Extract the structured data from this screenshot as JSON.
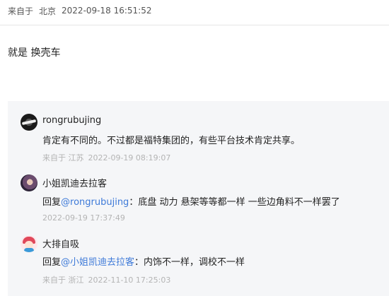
{
  "post": {
    "source_prefix": "来自于",
    "location": "北京",
    "datetime": "2022-09-18 16:51:52",
    "body": "就是 换壳车"
  },
  "replies": [
    {
      "username": "rongrubujing",
      "avatar_icon": "dark-logo-avatar",
      "content": "肯定有不同的。不过都是福特集团的，有些平台技术肯定共享。",
      "meta_source": "来自于 江苏",
      "datetime": "2022-09-19 08:19:07"
    },
    {
      "username": "小姐凯迪去拉客",
      "avatar_icon": "photo-avatar",
      "reply_prefix": "回复",
      "mention": "@rongrubujing",
      "content": "：底盘 动力 悬架等等都一样 一些边角料不一样罢了",
      "datetime": "2022-09-19 17:37:49"
    },
    {
      "username": "大排自吸",
      "avatar_icon": "cartoon-avatar",
      "reply_prefix": "回复",
      "mention": "@小姐凯迪去拉客",
      "content": "：内饰不一样，调校不一样",
      "meta_source": "来自于 浙江",
      "datetime": "2022-11-10 17:25:03"
    }
  ]
}
